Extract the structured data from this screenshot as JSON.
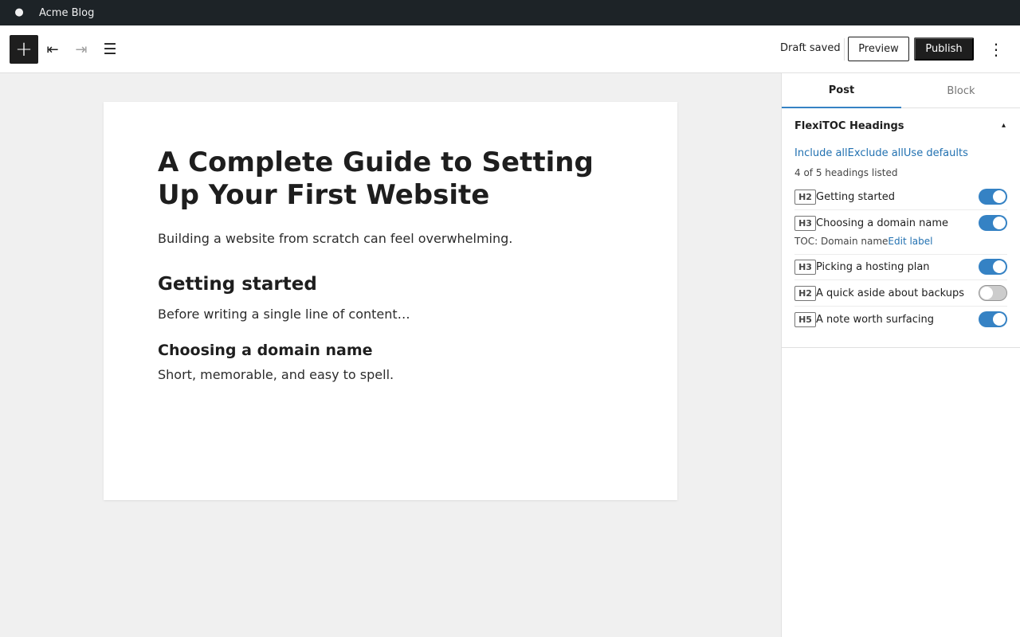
{
  "adminbar": {
    "logo_icon": "wordpress-icon",
    "site_name": "Acme Blog"
  },
  "toolbar": {
    "inserter_icon": "+",
    "undo_icon": "⇤",
    "redo_icon": "⇥",
    "listview_icon": "☰",
    "draft_status": "Draft saved",
    "preview_label": "Preview",
    "publish_label": "Publish",
    "more_icon": "⋮"
  },
  "post": {
    "title": "A Complete Guide to Setting Up Your First Website",
    "intro": "Building a website from scratch can feel overwhelming.",
    "heading_1": "Getting started",
    "para_1": "Before writing a single line of content…",
    "heading_2": "Choosing a domain name",
    "para_2": "Short, memorable, and easy to spell."
  },
  "sidebar": {
    "tabs": [
      {
        "label": "Post",
        "active": true
      },
      {
        "label": "Block",
        "active": false
      }
    ],
    "panel": {
      "title": "FlexiTOC Headings",
      "caret": "▴",
      "links": [
        "Include all",
        "Exclude all",
        "Use defaults"
      ],
      "count_text": "4 of 5 headings listed",
      "headings": [
        {
          "level": "H2",
          "label": "Getting started",
          "enabled": true
        },
        {
          "level": "H3",
          "label": "Choosing a domain name",
          "enabled": true,
          "toc_label": "TOC: Domain name",
          "edit_label": "Edit label"
        },
        {
          "level": "H3",
          "label": "Picking a hosting plan",
          "enabled": true
        },
        {
          "level": "H2",
          "label": "A quick aside about backups",
          "enabled": false
        },
        {
          "level": "H5",
          "label": "A note worth surfacing",
          "enabled": true
        }
      ]
    }
  },
  "colors": {
    "accent": "#3582c4",
    "link": "#2271b1",
    "admin_bar": "#1d2327",
    "dark_button": "#1e1e1e"
  }
}
